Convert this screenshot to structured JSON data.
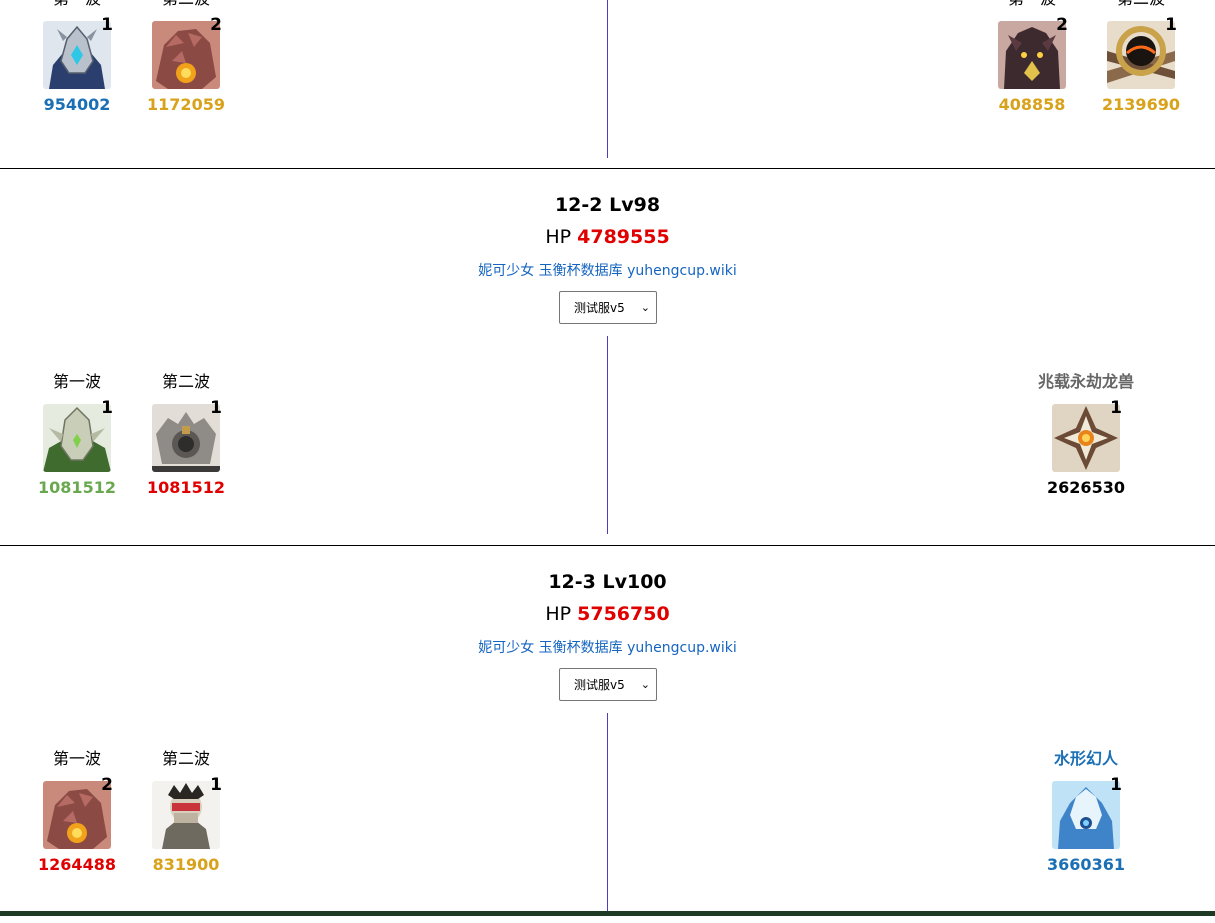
{
  "colors": {
    "blue": "#1a6fb5",
    "gold": "#d9a21b",
    "red": "#e00000",
    "green": "#6aa84f",
    "black": "#000000",
    "gray": "#666666",
    "link": "#1565c0",
    "vline": "#4b3fbf"
  },
  "sections": [
    {
      "title": "",
      "hp_label": "",
      "hp_value": "",
      "link": "",
      "select": "",
      "left": [
        {
          "label": "第一波",
          "count": "1",
          "hp": "954002",
          "icon": "armored-knight-icon"
        },
        {
          "label": "第二波",
          "count": "2",
          "hp": "1172059",
          "icon": "rock-beast-icon"
        }
      ],
      "right": [
        {
          "label": "第一波",
          "count": "2",
          "hp": "408858",
          "icon": "dark-beast-icon"
        },
        {
          "label": "第二波",
          "count": "1",
          "hp": "2139690",
          "icon": "ring-core-icon"
        }
      ]
    },
    {
      "title": "12-2 Lv98",
      "hp_label": "HP",
      "hp_value": "4789555",
      "link": "妮可少女 玉衡杯数据库 yuhengcup.wiki",
      "select": "测试服v5",
      "left": [
        {
          "label": "第一波",
          "count": "1",
          "hp": "1081512",
          "icon": "green-knight-icon"
        },
        {
          "label": "第二波",
          "count": "1",
          "hp": "1081512",
          "icon": "gear-construct-icon"
        }
      ],
      "right": [
        {
          "label": "兆载永劫龙兽",
          "count": "1",
          "hp": "2626530",
          "icon": "dragon-core-icon"
        }
      ]
    },
    {
      "title": "12-3 Lv100",
      "hp_label": "HP",
      "hp_value": "5756750",
      "link": "妮可少女 玉衡杯数据库 yuhengcup.wiki",
      "select": "测试服v5",
      "left": [
        {
          "label": "第一波",
          "count": "2",
          "hp": "1264488",
          "icon": "rock-beast-icon"
        },
        {
          "label": "第二波",
          "count": "1",
          "hp": "831900",
          "icon": "masked-fighter-icon"
        }
      ],
      "right": [
        {
          "label": "水形幻人",
          "count": "1",
          "hp": "3660361",
          "icon": "water-phantom-icon"
        }
      ]
    }
  ]
}
